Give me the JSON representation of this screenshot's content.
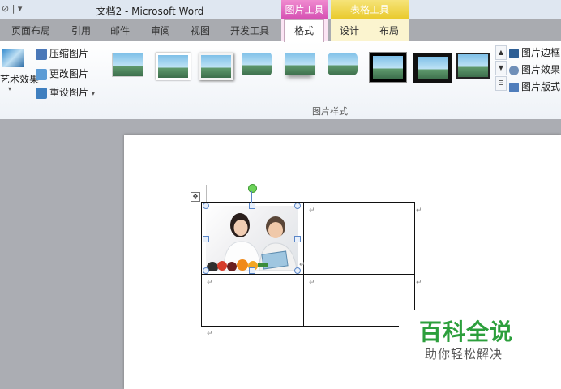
{
  "titlebar": {
    "title": "文档2 - Microsoft Word",
    "qat_glyph": "▾"
  },
  "context_tabs": {
    "picture_tools": "图片工具",
    "table_tools": "表格工具"
  },
  "tabs": [
    {
      "label": "页面布局"
    },
    {
      "label": "引用"
    },
    {
      "label": "邮件"
    },
    {
      "label": "审阅"
    },
    {
      "label": "视图"
    },
    {
      "label": "开发工具"
    },
    {
      "label": "格式"
    },
    {
      "label": "设计"
    },
    {
      "label": "布局"
    }
  ],
  "ribbon": {
    "artistic_effects": "艺术效果",
    "compress": "压缩图片",
    "change": "更改图片",
    "reset": "重设图片",
    "picture_border": "图片边框",
    "picture_effects": "图片效果",
    "picture_layout": "图片版式",
    "group_label": "图片样式"
  },
  "document": {
    "paragraph_mark": "↵"
  },
  "watermark": {
    "title": "百科全说",
    "subtitle": "助你轻松解决"
  },
  "colors": {
    "picture_tools": "#d54fb2",
    "table_tools": "#e9c92a",
    "watermark": "#2c9f3c"
  }
}
